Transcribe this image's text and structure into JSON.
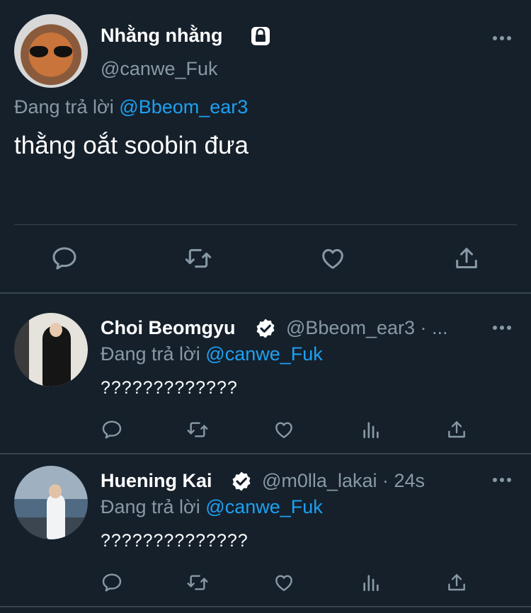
{
  "main_tweet": {
    "display_name": "Nhằng nhằng",
    "handle": "@canwe_Fuk",
    "reply_prefix": "Đang trả lời",
    "reply_mention": "@Bbeom_ear3",
    "text": "thằng oắt soobin đưa",
    "protected_icon": "lock-icon",
    "actions": [
      "reply-icon",
      "retweet-icon",
      "like-icon",
      "share-icon"
    ]
  },
  "replies": [
    {
      "display_name": "Choi Beomgyu",
      "verified_icon": "verified-badge-icon",
      "handle_time": "@Bbeom_ear3 · ...",
      "reply_prefix": "Đang trả lời",
      "reply_mention": "@canwe_Fuk",
      "text": "?????????????",
      "actions": [
        "reply-icon",
        "retweet-icon",
        "like-icon",
        "analytics-icon",
        "share-icon"
      ]
    },
    {
      "display_name": "Huening Kai",
      "verified_icon": "verified-badge-icon",
      "handle_time": "@m0lla_lakai · 24s",
      "reply_prefix": "Đang trả lời",
      "reply_mention": "@canwe_Fuk",
      "text": "??????????????",
      "actions": [
        "reply-icon",
        "retweet-icon",
        "like-icon",
        "analytics-icon",
        "share-icon"
      ]
    }
  ],
  "colors": {
    "background": "#15202b",
    "text": "#ffffff",
    "secondary_text": "#8899a6",
    "link": "#1da1f2",
    "divider": "#38444d"
  }
}
